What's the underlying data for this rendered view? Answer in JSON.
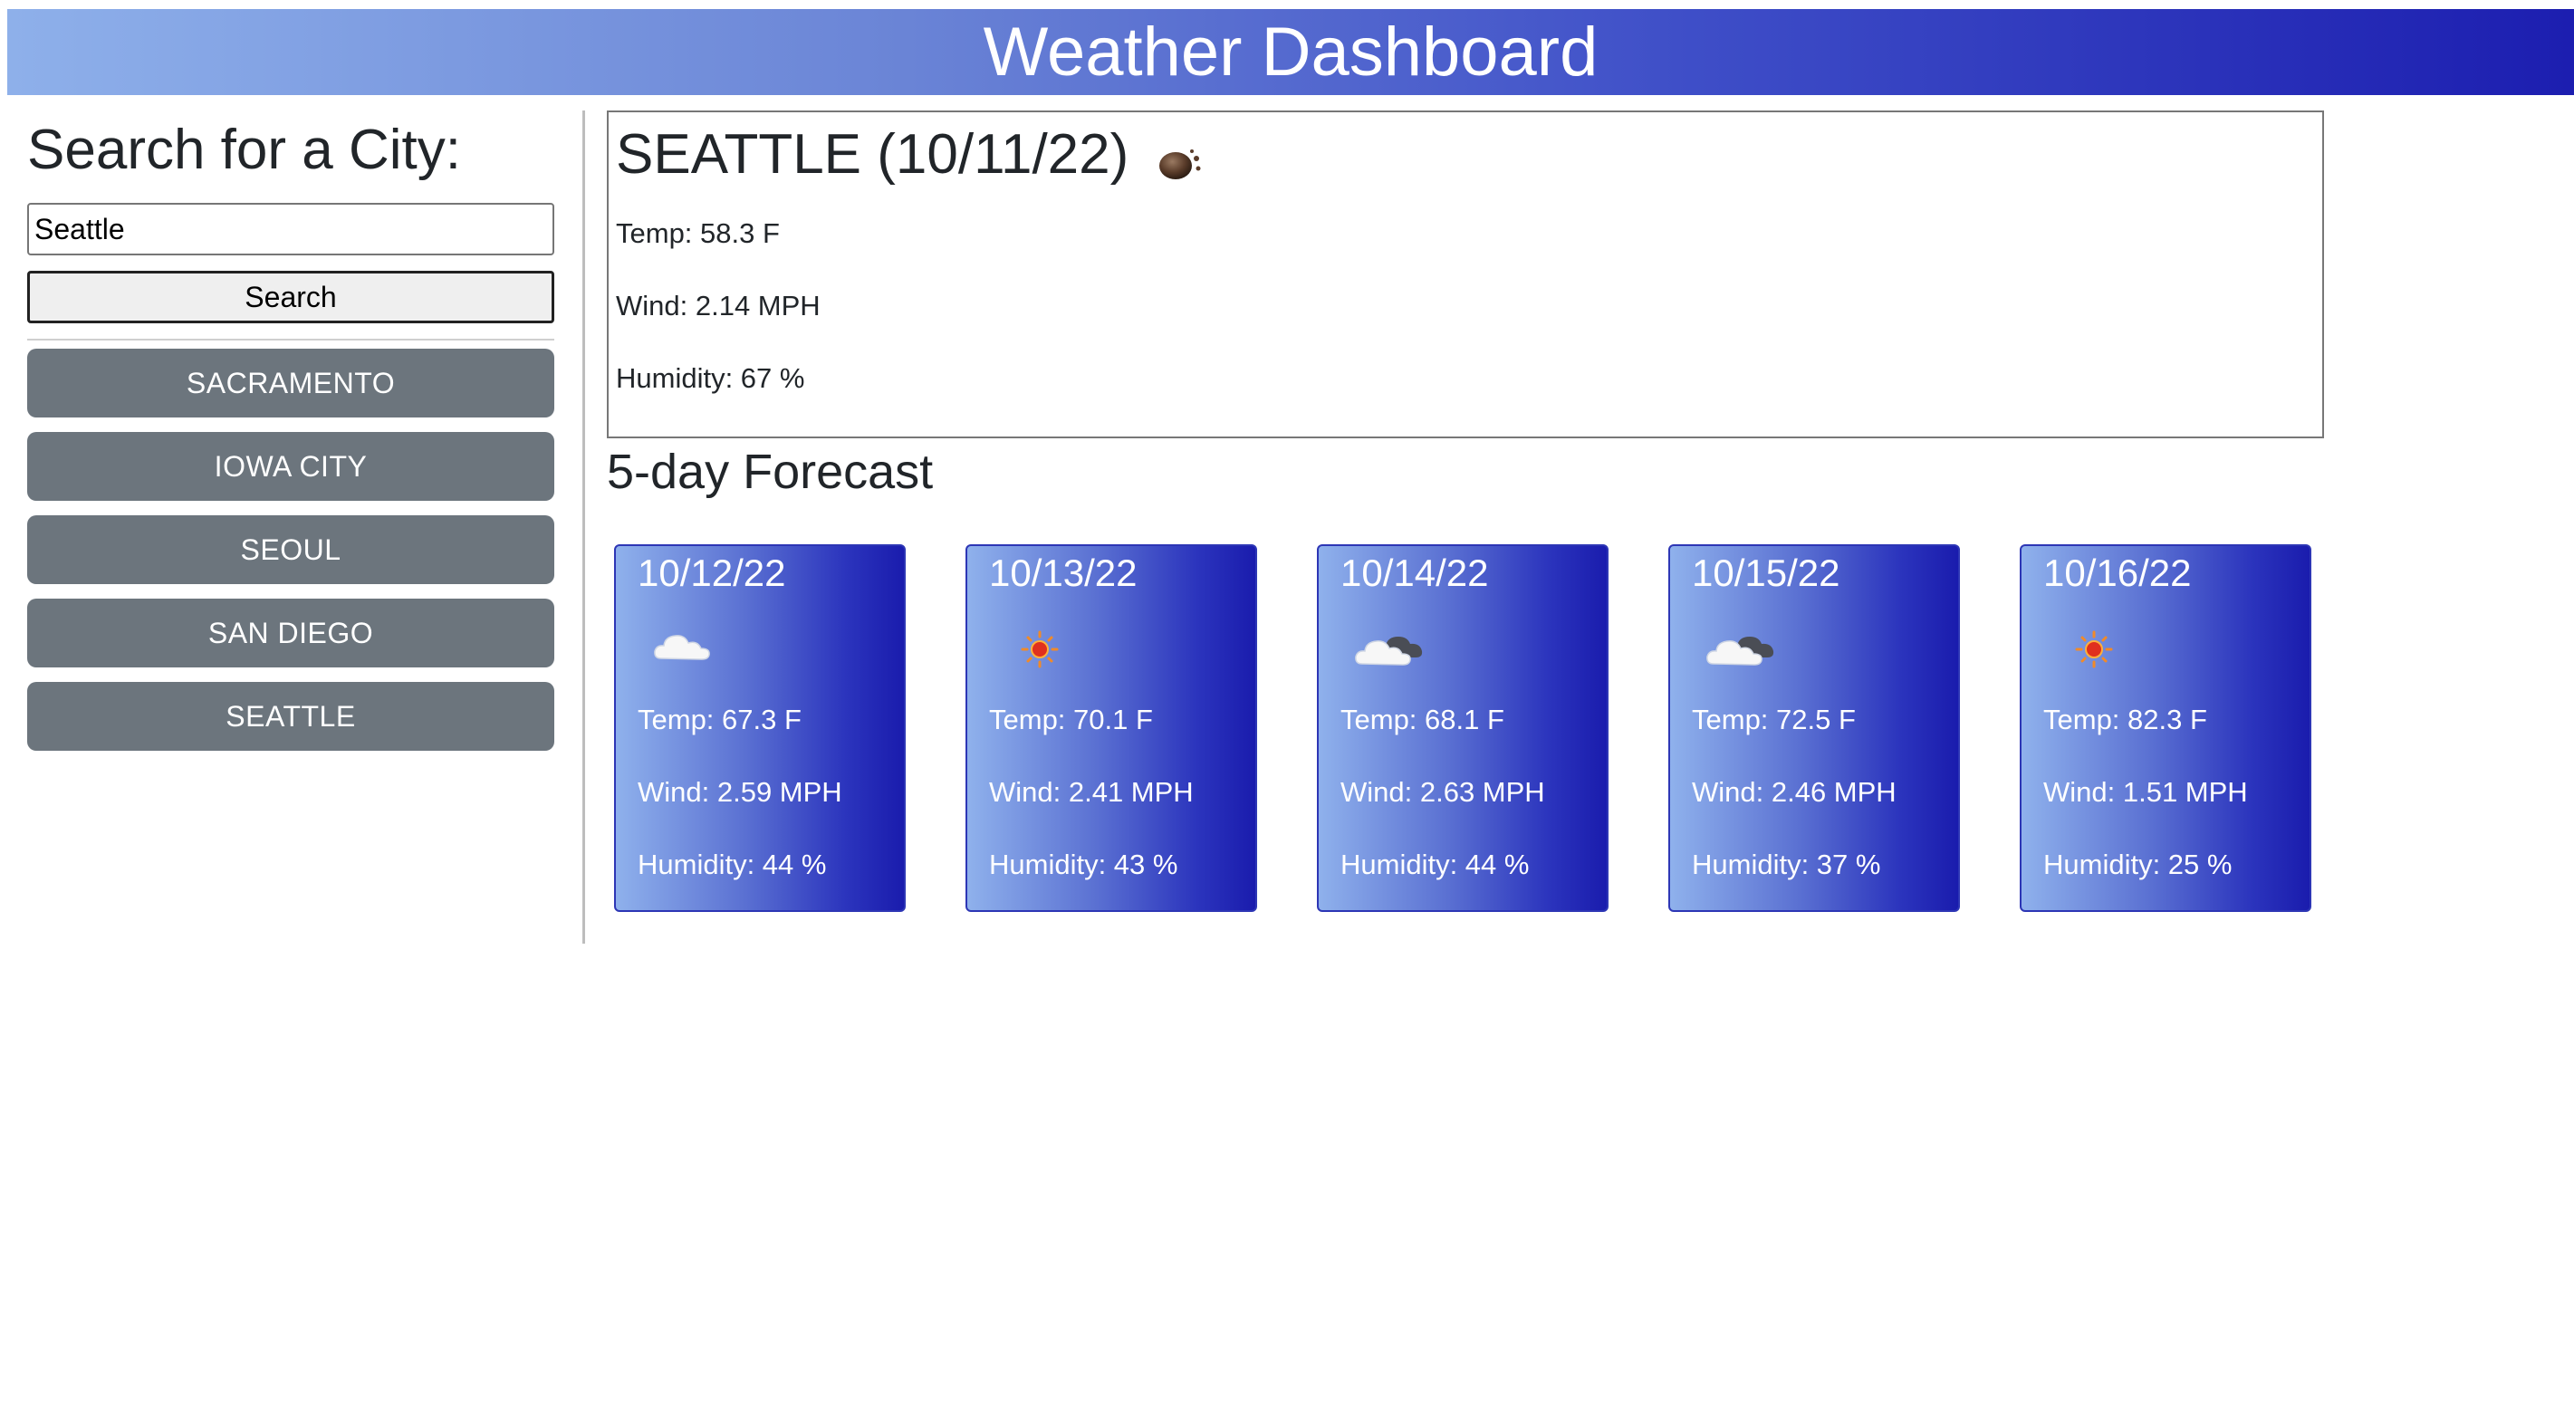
{
  "header": {
    "title": "Weather Dashboard"
  },
  "sidebar": {
    "search_title": "Search for a City:",
    "search_input_value": "Seattle",
    "search_button_label": "Search",
    "history": [
      "SACRAMENTO",
      "IOWA CITY",
      "SEOUL",
      "SAN DIEGO",
      "SEATTLE"
    ]
  },
  "current": {
    "title": "SEATTLE (10/11/22)",
    "icon": "mist-icon",
    "temp": "Temp: 58.3 F",
    "wind": "Wind: 2.14 MPH",
    "humidity": "Humidity: 67 %"
  },
  "forecast": {
    "title": "5-day Forecast",
    "days": [
      {
        "date": "10/12/22",
        "icon": "cloud-icon",
        "temp": "Temp: 67.3 F",
        "wind": "Wind: 2.59 MPH",
        "humidity": "Humidity: 44 %"
      },
      {
        "date": "10/13/22",
        "icon": "sun-icon",
        "temp": "Temp: 70.1 F",
        "wind": "Wind: 2.41 MPH",
        "humidity": "Humidity: 43 %"
      },
      {
        "date": "10/14/22",
        "icon": "broken-clouds-icon",
        "temp": "Temp: 68.1 F",
        "wind": "Wind: 2.63 MPH",
        "humidity": "Humidity: 44 %"
      },
      {
        "date": "10/15/22",
        "icon": "broken-clouds-icon",
        "temp": "Temp: 72.5 F",
        "wind": "Wind: 2.46 MPH",
        "humidity": "Humidity: 37 %"
      },
      {
        "date": "10/16/22",
        "icon": "sun-icon",
        "temp": "Temp: 82.3 F",
        "wind": "Wind: 1.51 MPH",
        "humidity": "Humidity: 25 %"
      }
    ]
  },
  "colors": {
    "header_gradient_start": "#8eb0ea",
    "header_gradient_end": "#1c1eb0",
    "history_button_bg": "#6c757d"
  }
}
